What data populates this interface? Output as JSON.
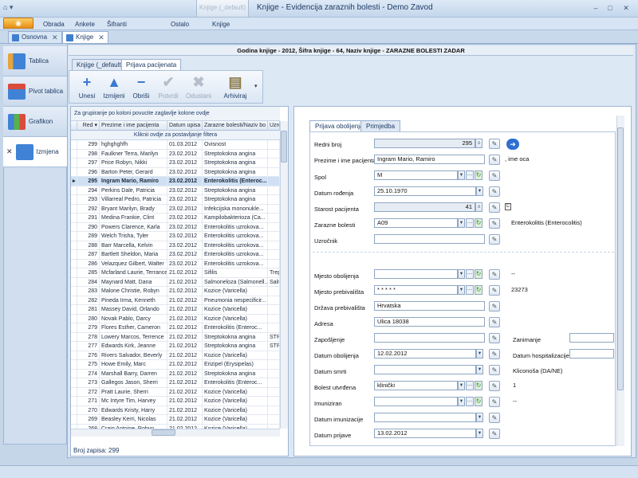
{
  "window": {
    "title": "Knjige - Evidencija zaraznih bolesti - Demo Zavod",
    "context_tab": "Knjige (_default)",
    "minimize": "–",
    "maximize": "□",
    "close": "✕"
  },
  "ribbon": {
    "app_button": "",
    "tabs": [
      "Obrada",
      "Ankete",
      "Šifranti",
      "Ostalo",
      "Knjige"
    ]
  },
  "doc_tabs": [
    {
      "label": "Osnovna"
    },
    {
      "label": "Knjige"
    }
  ],
  "sidebar": {
    "items": [
      {
        "label": "Tablica"
      },
      {
        "label": "Pivot tablica"
      },
      {
        "label": "Grafikon"
      },
      {
        "label": "Izmjena"
      }
    ]
  },
  "header": {
    "text": "Godina knjige - 2012, Šifra knjige - 64, Naziv knjige - ZARAZNE BOLESTI ZADAR"
  },
  "subtabs": [
    "Knjige (_default)",
    "Prijava pacijenata"
  ],
  "toolbar": {
    "unesi": "Unesi",
    "izmijeni": "Izmijeni",
    "obrisi": "Obriši",
    "potvrdi": "Potvrdi",
    "odustani": "Odustani",
    "arhiviraj": "Arhiviraj"
  },
  "grid": {
    "group_hint": "Za grupiranje po koloni povucite zaglavlje kolone ovdje",
    "filter_hint": "Kliknii ovdje za postavljanje filtera",
    "columns": [
      "Red",
      "Prezime i ime pacijenta",
      "Datum upisa",
      "Zarazne bolesti/Naziv bo",
      "Uzro"
    ],
    "rows": [
      [
        "299",
        "hghghghfh",
        "01.03.2012",
        "Ovisnost",
        ""
      ],
      [
        "298",
        "Faulkner Terra, Marilyn",
        "23.02.2012",
        "Streptokokna angina",
        ""
      ],
      [
        "297",
        "Price Robyn, Nikki",
        "23.02.2012",
        "Streptokokna angina",
        ""
      ],
      [
        "296",
        "Barton Peter, Gerard",
        "23.02.2012",
        "Streptokokna angina",
        ""
      ],
      [
        "295",
        "Ingram Mario, Ramiro",
        "23.02.2012",
        "Enterokolitis (Enteroc...",
        ""
      ],
      [
        "294",
        "Perkins Dale, Patricia",
        "23.02.2012",
        "Streptokokna angina",
        ""
      ],
      [
        "293",
        "Villarreal Pedro, Patricia",
        "23.02.2012",
        "Streptokokna angina",
        ""
      ],
      [
        "292",
        "Bryant Marilyn, Brady",
        "23.02.2012",
        "Infekcijska mononukle...",
        ""
      ],
      [
        "291",
        "Medina Frankie, Clint",
        "23.02.2012",
        "Kampilobakterioza (Ca...",
        ""
      ],
      [
        "290",
        "Powers Clarence, Karla",
        "23.02.2012",
        "Enterokolitis uzrokova...",
        ""
      ],
      [
        "289",
        "Welch Trisha, Tyler",
        "23.02.2012",
        "Enterokolitis uzrokova...",
        ""
      ],
      [
        "288",
        "Barr Marcella, Kelvin",
        "23.02.2012",
        "Enterokolitis uzrokova...",
        ""
      ],
      [
        "287",
        "Bartlett Sheldon, Maria",
        "23.02.2012",
        "Enterokolitis uzrokova...",
        ""
      ],
      [
        "286",
        "Velazquez Gilbert, Walter",
        "23.02.2012",
        "Enterokolitis uzrokova...",
        ""
      ],
      [
        "285",
        "Mcfarland Laurie, Terrance",
        "21.02.2012",
        "Sifilis",
        "Trep"
      ],
      [
        "284",
        "Maynard Matt, Dana",
        "21.02.2012",
        "Salmoneloza (Salmonell...",
        "Salm"
      ],
      [
        "283",
        "Malone Christie, Robyn",
        "21.02.2012",
        "Kozice (Varicella)",
        ""
      ],
      [
        "282",
        "Pineda Irma, Kenneth",
        "21.02.2012",
        "Pneumonia nespecificir...",
        ""
      ],
      [
        "281",
        "Massey David, Orlando",
        "21.02.2012",
        "Kozice (Varicella)",
        ""
      ],
      [
        "280",
        "Novak Pablo, Darcy",
        "21.02.2012",
        "Kozice (Varicella)",
        ""
      ],
      [
        "279",
        "Flores Esther, Cameron",
        "21.02.2012",
        "Enterokolitis (Enteroc...",
        ""
      ],
      [
        "278",
        "Lowery Marcos, Terrence",
        "21.02.2012",
        "Streptokokna angina",
        "STR"
      ],
      [
        "277",
        "Edwards Kirk, Jeanne",
        "21.02.2012",
        "Streptokokna angina",
        "STR"
      ],
      [
        "276",
        "Rivers Salvador, Beverly",
        "21.02.2012",
        "Kozice (Varicella)",
        ""
      ],
      [
        "275",
        "Howe Emily, Marc",
        "21.02.2012",
        "Erizipel (Erysipelas)",
        ""
      ],
      [
        "274",
        "Marshall Barry, Darren",
        "21.02.2012",
        "Streptokokna angina",
        ""
      ],
      [
        "273",
        "Gallegos Jason, Sherri",
        "21.02.2012",
        "Enterokolitis (Enteroc...",
        ""
      ],
      [
        "272",
        "Pratt Laurie, Sherri",
        "21.02.2012",
        "Kozice (Varicella)",
        ""
      ],
      [
        "271",
        "Mc Intyre Tim, Harvey",
        "21.02.2012",
        "Kozice (Varicella)",
        ""
      ],
      [
        "270",
        "Edwards Kristy, Harry",
        "21.02.2012",
        "Kozice (Varicella)",
        ""
      ],
      [
        "269",
        "Beasley Kerri, Nicolas",
        "21.02.2012",
        "Kozice (Varicella)",
        ""
      ],
      [
        "268",
        "Craig Antoine, Robyn",
        "21.02.2012",
        "Kozice (Varicella)",
        ""
      ]
    ],
    "row_count": "Broj zapisa: 299"
  },
  "form": {
    "tabs": [
      "Prijava obolijenja",
      "Primjedba"
    ],
    "redni_broj": {
      "label": "Redni broj",
      "value": "295"
    },
    "prezime": {
      "label": "Prezime i ime pacijenta",
      "value": "Ingram Mario, Ramiro",
      "info": ", ime oca"
    },
    "spol": {
      "label": "Spol",
      "value": "M"
    },
    "datum_rodenja": {
      "label": "Datum rođenja",
      "value": "25.10.1970"
    },
    "starost": {
      "label": "Starost pacijenta",
      "value": "41"
    },
    "zarazne": {
      "label": "Zarazne bolesti",
      "value": "A09",
      "info": "Enterokolitis (Enterocolitis)"
    },
    "uzrocnik": {
      "label": "Uzročnik",
      "value": ""
    },
    "mjesto_obolijenja": {
      "label": "Mjesto obolijenja",
      "value": "",
      "info": "--"
    },
    "mjesto_prebivalista": {
      "label": "Mjesto prebivališta",
      "value": "* * * * *",
      "info": "23273"
    },
    "drzava": {
      "label": "Država prebivališta",
      "value": "Hrvatska"
    },
    "adresa": {
      "label": "Adresa",
      "value": "Ulica 18038"
    },
    "zaposljenje": {
      "label": "Zapošljenje",
      "value": ""
    },
    "zanimanje": {
      "label": "Zanimanje",
      "value": ""
    },
    "datum_obolijenja": {
      "label": "Datum obolijenja",
      "value": "12.02.2012"
    },
    "datum_hosp": {
      "label": "Datum hospitalizacije",
      "value": ""
    },
    "datum_smrti": {
      "label": "Datum smrti",
      "value": ""
    },
    "klicenosa": {
      "label": "Kliconoša (DA/NE)"
    },
    "bolest_utvrdena": {
      "label": "Bolest utvrđena",
      "value": "klinički",
      "info": "1"
    },
    "imuniziran": {
      "label": "Imuniziran",
      "value": "",
      "info": "--"
    },
    "datum_imunizacije": {
      "label": "Datum imunizacije",
      "value": ""
    },
    "datum_prijave": {
      "label": "Datum prijave",
      "value": "13.02.2012"
    }
  }
}
